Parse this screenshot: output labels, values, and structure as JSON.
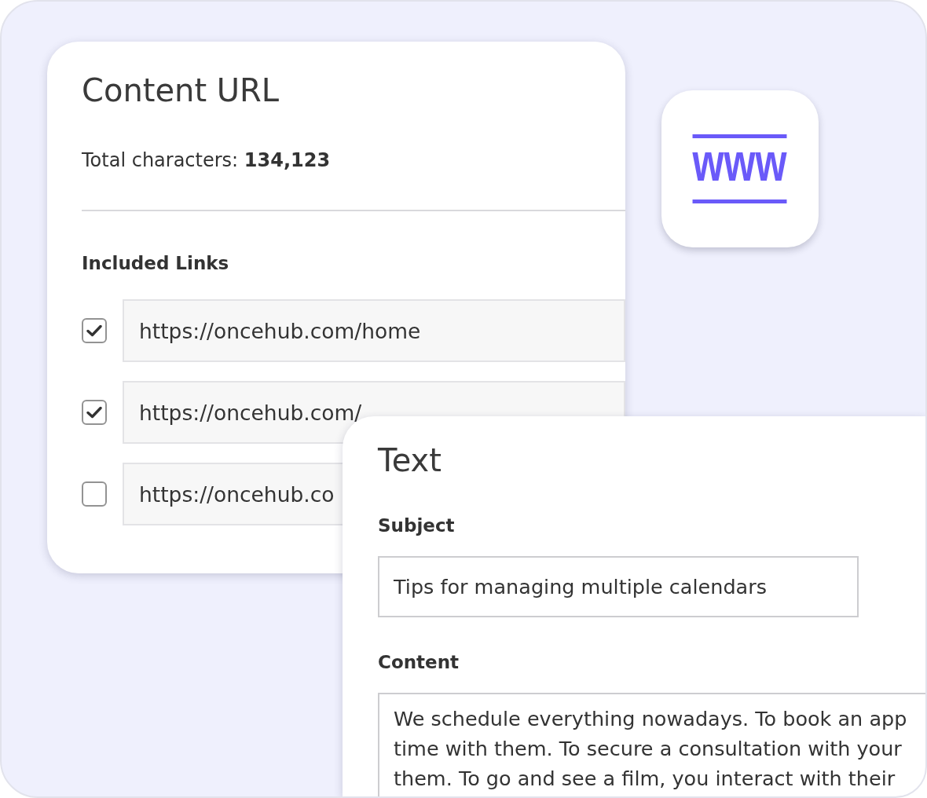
{
  "content_url_card": {
    "title": "Content URL",
    "total": "Total characters: **134,123**",
    "links_heading": "Included Links",
    "links": [
      {
        "url": "https://oncehub.com/home",
        "checked": true
      },
      {
        "url": "https://oncehub.com/",
        "checked": true
      },
      {
        "url": "https://oncehub.co",
        "checked": false
      }
    ]
  },
  "url_tile": {
    "label": "www"
  },
  "text_card": {
    "title": "Text",
    "subject_label": "Subject",
    "subject_value": "Tips for managing multiple calendars",
    "content_label": "Content",
    "content_lines": [
      "We schedule everything nowadays. To book an app",
      "time with them. To secure a consultation with your",
      "them. To go and see a film, you interact with their"
    ]
  }
}
